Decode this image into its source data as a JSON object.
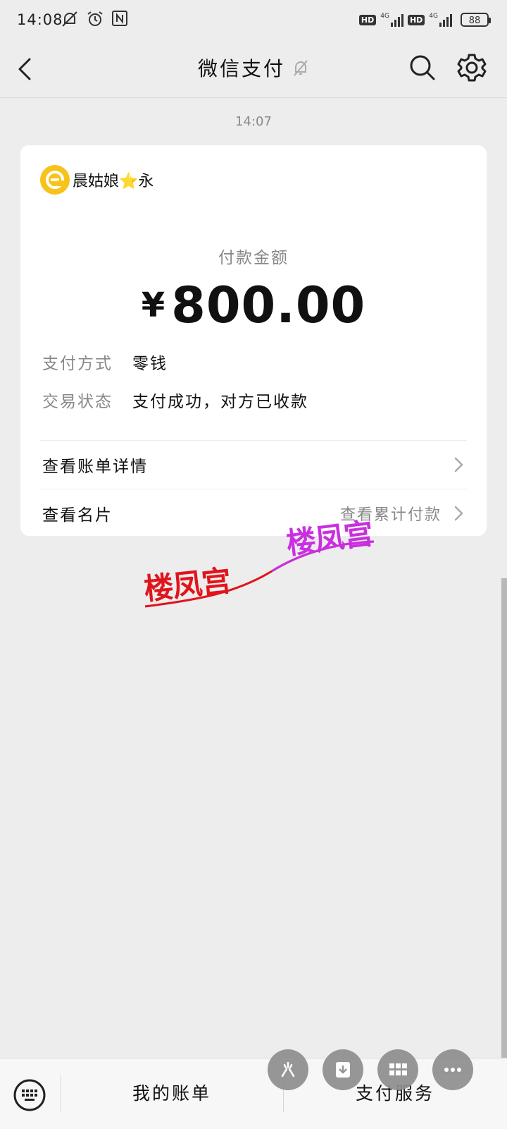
{
  "status_bar": {
    "time": "14:08",
    "icons_left": [
      "mute-notification-icon",
      "alarm-icon",
      "nfc-icon"
    ],
    "network_1": "4G",
    "network_2": "4G",
    "hd_label": "HD",
    "battery": "88"
  },
  "header": {
    "title": "微信支付",
    "back_icon": "back-arrow-icon",
    "mute_icon": "bell-off-icon",
    "search_icon": "search-icon",
    "settings_icon": "gear-icon"
  },
  "message": {
    "timestamp": "14:07",
    "merchant_name": "晨姑娘⭐永",
    "amount_label": "付款金额",
    "currency_symbol": "¥",
    "amount": "800.00",
    "details": [
      {
        "key": "支付方式",
        "value": "零钱"
      },
      {
        "key": "交易状态",
        "value": "支付成功，对方已收款"
      }
    ],
    "links": [
      {
        "label": "查看账单详情",
        "right_text": ""
      },
      {
        "label": "查看名片",
        "right_text": "查看累计付款"
      }
    ]
  },
  "watermark": {
    "text_1": "楼凤宫",
    "text_2": "楼凤宫"
  },
  "bottom_bar": {
    "keyboard_icon": "keyboard-icon",
    "menu_1": "我的账单",
    "menu_2": "支付服务",
    "floating_icons": [
      "game-icon",
      "download-icon",
      "grid-icon",
      "more-icon"
    ]
  },
  "colors": {
    "background": "#ededed",
    "card": "#ffffff",
    "avatar": "#f7c31b",
    "watermark_red": "#e1141c",
    "watermark_purple": "#c92fe0"
  }
}
